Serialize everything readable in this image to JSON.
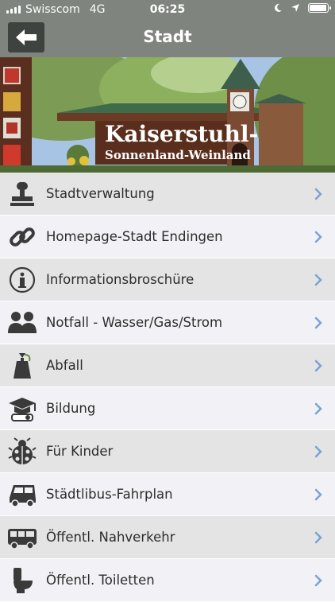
{
  "status": {
    "carrier": "Swisscom",
    "network": "4G",
    "time": "06:25",
    "battery_level": 0.95
  },
  "nav": {
    "title": "Stadt",
    "back_icon": "arrow-left-icon"
  },
  "banner": {
    "sign_line1": "Kaiserstuhl-",
    "sign_line2": "Sonnenland-Weinland"
  },
  "colors": {
    "nav_bg": "#7f847f",
    "back_bg": "#3f433f",
    "row_odd": "#e4e4e4",
    "row_even": "#f2f2f6",
    "chevron": "#7aa2d6",
    "icon": "#3a3a3a"
  },
  "menu": [
    {
      "label": "Stadtverwaltung",
      "icon": "stamp-icon"
    },
    {
      "label": "Homepage-Stadt Endingen",
      "icon": "link-icon"
    },
    {
      "label": "Informationsbroschüre",
      "icon": "info-icon"
    },
    {
      "label": "Notfall - Wasser/Gas/Strom",
      "icon": "people-icon"
    },
    {
      "label": "Abfall",
      "icon": "trash-bag-icon"
    },
    {
      "label": "Bildung",
      "icon": "graduation-icon"
    },
    {
      "label": "Für Kinder",
      "icon": "ladybug-icon"
    },
    {
      "label": "Städtlibus-Fahrplan",
      "icon": "minibus-icon"
    },
    {
      "label": "Öffentl. Nahverkehr",
      "icon": "bus-icon"
    },
    {
      "label": "Öffentl. Toiletten",
      "icon": "toilet-icon"
    }
  ]
}
